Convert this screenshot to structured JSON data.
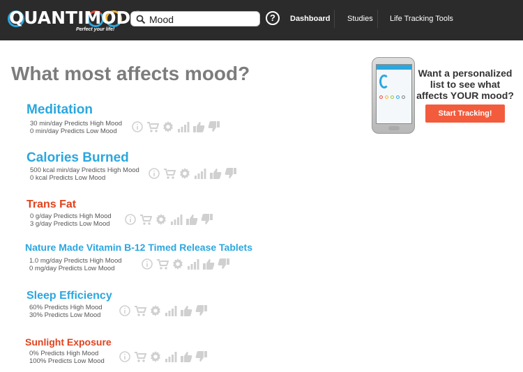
{
  "app": {
    "logo_text": "QUANTIMODO",
    "logo_tagline": "Perfect your life!"
  },
  "search": {
    "value": "Mood",
    "placeholder": ""
  },
  "nav": {
    "items": [
      {
        "label": "Dashboard",
        "active": true
      },
      {
        "label": "Studies",
        "active": false
      },
      {
        "label": "Life Tracking Tools",
        "active": false
      }
    ]
  },
  "page": {
    "title": "What most affects mood?"
  },
  "promo": {
    "text": "Want a personalized list to see what affects YOUR mood?",
    "button_label": "Start Tracking!"
  },
  "factors": [
    {
      "name": "Meditation",
      "color": "#2aa7df",
      "high": "30 min/day Predicts High Mood",
      "low": "0 min/day Predicts Low Mood"
    },
    {
      "name": "Calories Burned",
      "color": "#2aa7df",
      "high": "500 kcal min/day Predicts High Mood",
      "low": "0 kcal Predicts Low Mood"
    },
    {
      "name": "Trans Fat",
      "color": "#e0421e",
      "high": "0 g/day Predicts High Mood",
      "low": "3 g/day Predicts Low Mood"
    },
    {
      "name": "Nature Made Vitamin B-12 Timed Release Tablets",
      "color": "#2aa7df",
      "high": "1.0 mg/day Predicts High Mood",
      "low": "0 mg/day Predicts Low Mood"
    },
    {
      "name": "Sleep Efficiency",
      "color": "#2aa7df",
      "high": "60% Predicts High Mood",
      "low": "30% Predicts Low Mood"
    },
    {
      "name": "Sunlight Exposure",
      "color": "#e0421e",
      "high": "0% Predicts High Mood",
      "low": "100% Predicts Low Mood"
    }
  ],
  "icons": [
    "info-icon",
    "cart-icon",
    "gear-icon",
    "chart-icon",
    "thumbs-up-icon",
    "thumbs-down-icon"
  ],
  "colors": {
    "header_bg": "#2b2b2b",
    "accent_blue": "#2aa7df",
    "accent_red": "#e0421e",
    "cta": "#f25c3d"
  }
}
